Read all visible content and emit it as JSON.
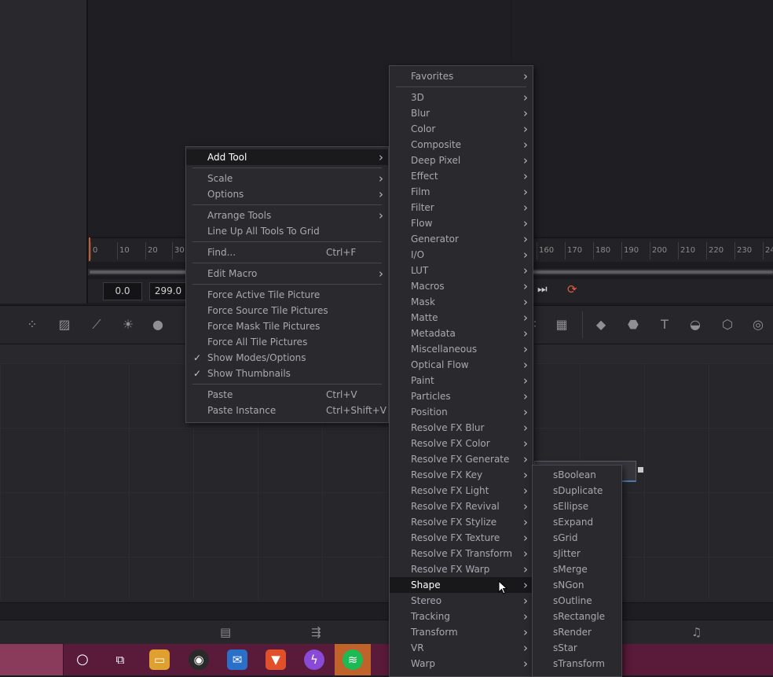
{
  "timeline": {
    "ticks_left": [
      "0",
      "10",
      "20",
      "30"
    ],
    "ticks_right": [
      "160",
      "170",
      "180",
      "190",
      "200",
      "210",
      "220",
      "230",
      "24"
    ],
    "start_value": "0.0",
    "end_value": "299.0"
  },
  "toolbar_icons": [
    "particle-icon",
    "gradient-icon",
    "curve-icon",
    "brightness-icon",
    "drop-icon",
    "effect-icon",
    "mask-icon",
    "plane-icon",
    "shape3d-icon",
    "text3d-icon",
    "merge3d-icon",
    "box3d-icon",
    "light-icon"
  ],
  "context_menu": {
    "groups": [
      [
        {
          "label": "Add Tool",
          "submenu": true,
          "highlight": true
        }
      ],
      [
        {
          "label": "Scale",
          "submenu": true
        },
        {
          "label": "Options",
          "submenu": true
        }
      ],
      [
        {
          "label": "Arrange Tools",
          "submenu": true
        },
        {
          "label": "Line Up All Tools To Grid"
        }
      ],
      [
        {
          "label": "Find...",
          "shortcut": "Ctrl+F"
        }
      ],
      [
        {
          "label": "Edit Macro",
          "submenu": true
        }
      ],
      [
        {
          "label": "Force Active Tile Picture"
        },
        {
          "label": "Force Source Tile Pictures"
        },
        {
          "label": "Force Mask Tile Pictures"
        },
        {
          "label": "Force All Tile Pictures"
        },
        {
          "label": "Show Modes/Options",
          "checked": true
        },
        {
          "label": "Show Thumbnails",
          "checked": true
        }
      ],
      [
        {
          "label": "Paste",
          "shortcut": "Ctrl+V"
        },
        {
          "label": "Paste Instance",
          "shortcut": "Ctrl+Shift+V"
        }
      ]
    ]
  },
  "category_menu": {
    "favorites": "Favorites",
    "items": [
      "3D",
      "Blur",
      "Color",
      "Composite",
      "Deep Pixel",
      "Effect",
      "Film",
      "Filter",
      "Flow",
      "Generator",
      "I/O",
      "LUT",
      "Macros",
      "Mask",
      "Matte",
      "Metadata",
      "Miscellaneous",
      "Optical Flow",
      "Paint",
      "Particles",
      "Position",
      "Resolve FX Blur",
      "Resolve FX Color",
      "Resolve FX Generate",
      "Resolve FX Key",
      "Resolve FX Light",
      "Resolve FX Revival",
      "Resolve FX Stylize",
      "Resolve FX Texture",
      "Resolve FX Transform",
      "Resolve FX Warp",
      "Shape",
      "Stereo",
      "Tracking",
      "Transform",
      "VR",
      "Warp"
    ],
    "active": "Shape"
  },
  "shape_menu": {
    "items": [
      "sBoolean",
      "sDuplicate",
      "sEllipse",
      "sExpand",
      "sGrid",
      "sJitter",
      "sMerge",
      "sNGon",
      "sOutline",
      "sRectangle",
      "sRender",
      "sStar",
      "sTransform"
    ]
  },
  "page_icons": [
    "media-page-icon",
    "edit-page-icon",
    "fairlight-page-icon"
  ],
  "taskbar": {
    "icons": [
      "cortana-icon",
      "task-view-icon",
      "file-explorer-icon",
      "obs-icon",
      "mail-icon",
      "brave-icon",
      "messenger-icon",
      "spotify-icon"
    ]
  },
  "colors": {
    "accent_playhead": "#c55a2a",
    "menu_bg": "#2a2a2e",
    "highlight_bg": "#18181b",
    "taskbar": "#5a1a3a"
  }
}
